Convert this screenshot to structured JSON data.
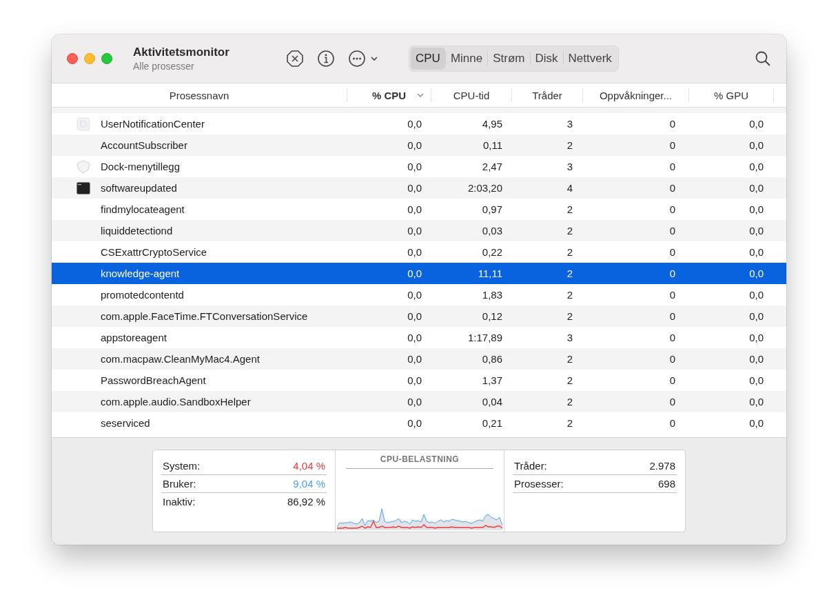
{
  "window": {
    "title": "Aktivitetsmonitor",
    "subtitle": "Alle prosesser"
  },
  "tabs": [
    {
      "label": "CPU",
      "selected": true
    },
    {
      "label": "Minne",
      "selected": false
    },
    {
      "label": "Strøm",
      "selected": false
    },
    {
      "label": "Disk",
      "selected": false
    },
    {
      "label": "Nettverk",
      "selected": false
    }
  ],
  "table": {
    "columns": [
      {
        "label": "Prosessnavn",
        "sorted": false
      },
      {
        "label": "% CPU",
        "sorted": true
      },
      {
        "label": "CPU-tid",
        "sorted": false
      },
      {
        "label": "Tråder",
        "sorted": false
      },
      {
        "label": "Oppvåkninger...",
        "sorted": false
      },
      {
        "label": "% GPU",
        "sorted": false
      }
    ],
    "rows": [
      {
        "kind": "window",
        "name": "UserNotificationCenter",
        "cpu": "0,0",
        "cpu_time": "4,95",
        "threads": "3",
        "wakeups": "0",
        "gpu": "0,0",
        "selected": false
      },
      {
        "kind": "plain",
        "name": "AccountSubscriber",
        "cpu": "0,0",
        "cpu_time": "0,11",
        "threads": "2",
        "wakeups": "0",
        "gpu": "0,0",
        "selected": false
      },
      {
        "kind": "shield",
        "name": "Dock-menytillegg",
        "cpu": "0,0",
        "cpu_time": "2,47",
        "threads": "3",
        "wakeups": "0",
        "gpu": "0,0",
        "selected": false
      },
      {
        "kind": "terminal",
        "name": "softwareupdated",
        "cpu": "0,0",
        "cpu_time": "2:03,20",
        "threads": "4",
        "wakeups": "0",
        "gpu": "0,0",
        "selected": false
      },
      {
        "kind": "plain",
        "name": "findmylocateagent",
        "cpu": "0,0",
        "cpu_time": "0,97",
        "threads": "2",
        "wakeups": "0",
        "gpu": "0,0",
        "selected": false
      },
      {
        "kind": "plain",
        "name": "liquiddetectiond",
        "cpu": "0,0",
        "cpu_time": "0,03",
        "threads": "2",
        "wakeups": "0",
        "gpu": "0,0",
        "selected": false
      },
      {
        "kind": "plain",
        "name": "CSExattrCryptoService",
        "cpu": "0,0",
        "cpu_time": "0,22",
        "threads": "2",
        "wakeups": "0",
        "gpu": "0,0",
        "selected": false
      },
      {
        "kind": "plain",
        "name": "knowledge-agent",
        "cpu": "0,0",
        "cpu_time": "11,11",
        "threads": "2",
        "wakeups": "0",
        "gpu": "0,0",
        "selected": true
      },
      {
        "kind": "plain",
        "name": "promotedcontentd",
        "cpu": "0,0",
        "cpu_time": "1,83",
        "threads": "2",
        "wakeups": "0",
        "gpu": "0,0",
        "selected": false
      },
      {
        "kind": "plain",
        "name": "com.apple.FaceTime.FTConversationService",
        "cpu": "0,0",
        "cpu_time": "0,12",
        "threads": "2",
        "wakeups": "0",
        "gpu": "0,0",
        "selected": false
      },
      {
        "kind": "plain",
        "name": "appstoreagent",
        "cpu": "0,0",
        "cpu_time": "1:17,89",
        "threads": "3",
        "wakeups": "0",
        "gpu": "0,0",
        "selected": false
      },
      {
        "kind": "plain",
        "name": "com.macpaw.CleanMyMac4.Agent",
        "cpu": "0,0",
        "cpu_time": "0,86",
        "threads": "2",
        "wakeups": "0",
        "gpu": "0,0",
        "selected": false
      },
      {
        "kind": "plain",
        "name": "PasswordBreachAgent",
        "cpu": "0,0",
        "cpu_time": "1,37",
        "threads": "2",
        "wakeups": "0",
        "gpu": "0,0",
        "selected": false
      },
      {
        "kind": "plain",
        "name": "com.apple.audio.SandboxHelper",
        "cpu": "0,0",
        "cpu_time": "0,04",
        "threads": "2",
        "wakeups": "0",
        "gpu": "0,0",
        "selected": false
      },
      {
        "kind": "plain",
        "name": "seserviced",
        "cpu": "0,0",
        "cpu_time": "0,21",
        "threads": "2",
        "wakeups": "0",
        "gpu": "0,0",
        "selected": false
      }
    ]
  },
  "cpu_stats": [
    {
      "label": "System:",
      "value": "4,04 %",
      "color": "#ef3a35"
    },
    {
      "label": "Bruker:",
      "value": "9,04 %",
      "color": "#4aa3ee"
    },
    {
      "label": "Inaktiv:",
      "value": "86,92 %",
      "color": "#1d1d1f"
    }
  ],
  "cpu_load": {
    "title": "CPU-BELASTNING"
  },
  "counts": [
    {
      "label": "Tråder:",
      "value": "2.978"
    },
    {
      "label": "Prosesser:",
      "value": "698"
    }
  ]
}
